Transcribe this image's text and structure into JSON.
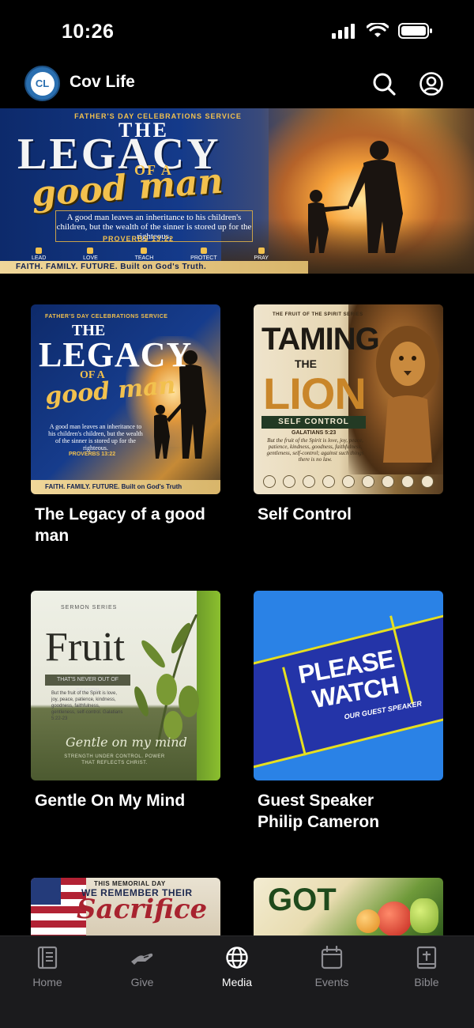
{
  "status_bar": {
    "time": "10:26"
  },
  "header": {
    "app_title": "Cov Life",
    "logo_initials": "CL"
  },
  "hero": {
    "eyebrow": "FATHER'S DAY CELEBRATIONS SERVICE",
    "title_the": "THE",
    "title_legacy": "LEGACY",
    "title_of_a": "OF A",
    "title_good_man": "good man",
    "quote": "A good man leaves an inheritance to his children's children, but the wealth of the sinner is stored up for the righteous.",
    "reference": "PROVERBS 13:22",
    "values": [
      "LEAD",
      "LOVE",
      "TEACH",
      "PROTECT",
      "PRAY"
    ],
    "tagline": "FAITH. FAMILY. FUTURE. Built on God's Truth."
  },
  "media_items": [
    {
      "title": "The Legacy of a good man",
      "thumb": {
        "eyebrow": "FATHER'S DAY CELEBRATIONS SERVICE",
        "the": "THE",
        "legacy": "LEGACY",
        "of_a": "OF A",
        "good_man": "good man",
        "quote": "A good man leaves an inheritance to his children's children, but the wealth of the sinner is stored up for the righteous.",
        "reference": "PROVERBS 13:22",
        "footer": "FAITH. FAMILY. FUTURE. Built on God's Truth"
      }
    },
    {
      "title": "Self Control",
      "thumb": {
        "eyebrow": "THE FRUIT OF THE SPIRIT SERIES",
        "taming": "TAMING",
        "the": "THE",
        "lion": "LION",
        "banner": "SELF CONTROL",
        "reference": "GALATIANS 5:23",
        "verse": "But the fruit of the Spirit is love, joy, peace, patience, kindness, goodness, faithfulness, gentleness, self-control; against such things there is no law."
      }
    },
    {
      "title": "Gentle On My Mind",
      "thumb": {
        "series": "SERMON SERIES",
        "fruit": "Fruit",
        "subtitle": "THAT'S NEVER OUT OF SEASON",
        "verse": "But the fruit of the Spirit is love, joy, peace, patience, kindness, goodness, faithfulness, gentleness, self-control. Galatians 5:22-23",
        "gentle": "Gentle on my mind",
        "strength": "STRENGTH UNDER CONTROL. POWER THAT REFLECTS CHRIST."
      }
    },
    {
      "title": "Guest Speaker Philip Cameron",
      "thumb": {
        "please": "PLEASE",
        "watch": "WATCH",
        "sub": "OUR GUEST SPEAKER"
      }
    },
    {
      "title": "",
      "thumb": {
        "eyebrow": "THIS MEMORIAL DAY",
        "remember": "WE REMEMBER THEIR",
        "sacrifice": "Sacrifice"
      }
    },
    {
      "title": "",
      "thumb": {
        "got": "GOT"
      }
    }
  ],
  "tab_bar": {
    "tabs": [
      {
        "label": "Home",
        "icon": "book-icon"
      },
      {
        "label": "Give",
        "icon": "give-hand-icon"
      },
      {
        "label": "Media",
        "icon": "globe-icon",
        "active": true
      },
      {
        "label": "Events",
        "icon": "calendar-icon"
      },
      {
        "label": "Bible",
        "icon": "bible-icon"
      }
    ]
  },
  "colors": {
    "background": "#000000",
    "tab_active": "#ffffff",
    "tab_inactive": "#8e8e93",
    "brand_blue": "#2a6fb0"
  }
}
